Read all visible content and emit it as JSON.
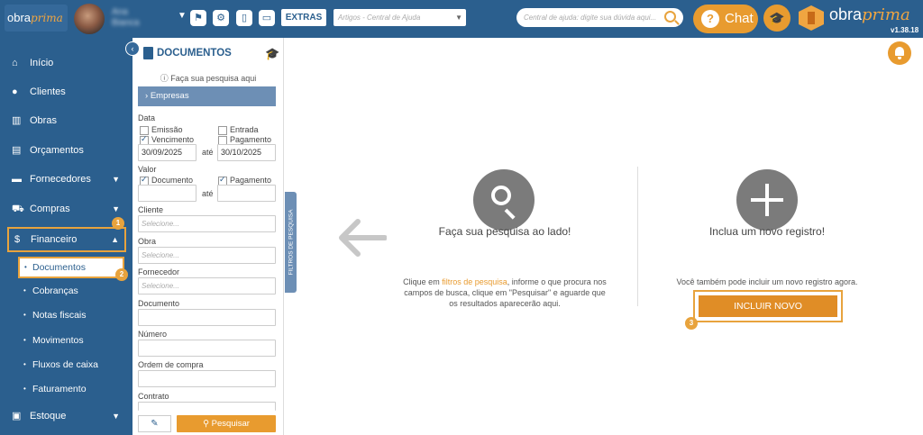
{
  "header": {
    "logo_text": "obra",
    "logo_accent": "prima",
    "user_name_line1": "Ana",
    "user_name_line2": "Bianca",
    "extras_label": "EXTRAS",
    "artigos_placeholder": "Artigos - Central de Ajuda",
    "help_search_placeholder": "Central de ajuda: digite sua dúvida aqui...",
    "chat_label": "Chat",
    "brand_text": "obra",
    "brand_accent": "prima",
    "version": "v1.38.18"
  },
  "sidebar": {
    "items": [
      {
        "label": "Início",
        "icon": "home-icon"
      },
      {
        "label": "Clientes",
        "icon": "user-icon"
      },
      {
        "label": "Obras",
        "icon": "building-icon"
      },
      {
        "label": "Orçamentos",
        "icon": "calculator-icon"
      },
      {
        "label": "Fornecedores",
        "icon": "truck-icon"
      },
      {
        "label": "Compras",
        "icon": "cart-icon"
      },
      {
        "label": "Financeiro",
        "icon": "dollar-icon"
      },
      {
        "label": "Estoque",
        "icon": "box-icon"
      }
    ],
    "financeiro_sub": [
      "Documentos",
      "Cobranças",
      "Notas fiscais",
      "Movimentos",
      "Fluxos de caixa",
      "Faturamento"
    ]
  },
  "filters": {
    "title": "DOCUMENTOS",
    "hint": "Faça sua pesquisa aqui",
    "empresas": "Empresas",
    "data_label": "Data",
    "cb_emissao": "Emissão",
    "cb_entrada": "Entrada",
    "cb_vencimento": "Vencimento",
    "cb_pagamento": "Pagamento",
    "date_from": "30/09/2025",
    "date_to": "30/10/2025",
    "ate": "até",
    "valor_label": "Valor",
    "cb_documento": "Documento",
    "cb_valor_pagamento": "Pagamento",
    "cliente_label": "Cliente",
    "cliente_placeholder": "Selecione...",
    "obra_label": "Obra",
    "obra_placeholder": "Selecione...",
    "fornecedor_label": "Fornecedor",
    "fornecedor_placeholder": "Selecione...",
    "documento_label": "Documento",
    "numero_label": "Número",
    "ordem_label": "Ordem de compra",
    "contrato_label": "Contrato",
    "search_button": "Pesquisar",
    "side_tab": "FILTROS DE PESQUISA"
  },
  "main": {
    "left_heading": "Faça sua pesquisa ao lado!",
    "left_p1_a": "Clique em ",
    "left_p1_hl": "filtros de pesquisa",
    "left_p1_b": ", informe o que procura nos",
    "left_p2": "campos de busca, clique em \"Pesquisar\" e aguarde que",
    "left_p3": "os resultados aparecerão aqui.",
    "right_heading": "Inclua um novo registro!",
    "right_p": "Você também pode incluir um novo registro agora.",
    "incluir_button": "INCLUIR NOVO"
  },
  "badges": [
    "1",
    "2",
    "3"
  ],
  "colors": {
    "primary": "#2b5f8e",
    "accent": "#e89b2f",
    "highlight_border": "#e8a33d"
  }
}
